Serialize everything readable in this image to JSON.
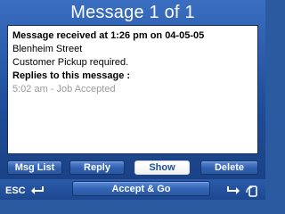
{
  "window": {
    "title": "Message 1 of 1"
  },
  "message": {
    "header": "Message received at 1:26 pm on 04-05-05",
    "street": "Blenheim Street",
    "body": "Customer Pickup required.",
    "replies_title": "Replies to this message :",
    "replies": [
      "5:02 am - Job Accepted"
    ]
  },
  "buttons": {
    "msg_list": "Msg List",
    "reply": "Reply",
    "show": "Show",
    "delete": "Delete",
    "accept_go": "Accept & Go",
    "esc": "ESC"
  },
  "icons": {
    "esc_arrow": "return-arrow-icon",
    "forward_arrow": "forward-arrow-icon",
    "rotate": "rotate-device-icon"
  },
  "colors": {
    "background_blue": "#1f4c97",
    "panel_white": "#ffffff",
    "active_button_text": "#1a4ea8"
  }
}
